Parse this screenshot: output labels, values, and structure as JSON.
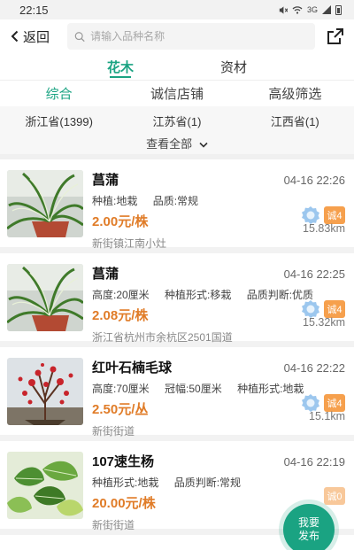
{
  "status": {
    "time": "22:15",
    "network": "3G"
  },
  "header": {
    "back_label": "返回",
    "search_placeholder": "请输入品种名称"
  },
  "top_tabs": [
    {
      "label": "花木"
    },
    {
      "label": "资材"
    }
  ],
  "sub_tabs": [
    {
      "label": "综合"
    },
    {
      "label": "诚信店铺"
    },
    {
      "label": "高级筛选"
    }
  ],
  "provinces": [
    {
      "label": "浙江省(1399)"
    },
    {
      "label": "江苏省(1)"
    },
    {
      "label": "江西省(1)"
    }
  ],
  "view_all_label": "查看全部",
  "items": [
    {
      "name": "菖蒲",
      "date": "04-16 22:26",
      "specs": [
        "种植:地栽",
        "品质:常规"
      ],
      "price": "2.00元/株",
      "location": "新街镇江南小灶",
      "distance": "15.83km",
      "badge": "诚4",
      "image": "spider-plant-icon"
    },
    {
      "name": "菖蒲",
      "date": "04-16 22:25",
      "specs": [
        "高度:20厘米",
        "种植形式:移栽",
        "品质判断:优质"
      ],
      "price": "2.08元/株",
      "location": "浙江省杭州市余杭区2501国道",
      "distance": "15.32km",
      "badge": "诚4",
      "image": "spider-plant-icon"
    },
    {
      "name": "红叶石楠毛球",
      "date": "04-16 22:22",
      "specs": [
        "高度:70厘米",
        "冠幅:50厘米",
        "种植形式:地栽"
      ],
      "price": "2.50元/丛",
      "location": "新街街道",
      "distance": "15.1km",
      "badge": "诚4",
      "image": "red-shrub-icon"
    },
    {
      "name": "107速生杨",
      "date": "04-16 22:19",
      "specs": [
        "种植形式:地栽",
        "品质判断:常规"
      ],
      "price": "20.00元/株",
      "location": "新街街道",
      "distance": "",
      "badge": "诚0",
      "image": "poplar-leaves-icon"
    }
  ],
  "publish_button": {
    "line1": "我要",
    "line2": "发布"
  },
  "colors": {
    "accent": "#1aa382",
    "price": "#e07c28",
    "badge": "#f6a04d"
  }
}
